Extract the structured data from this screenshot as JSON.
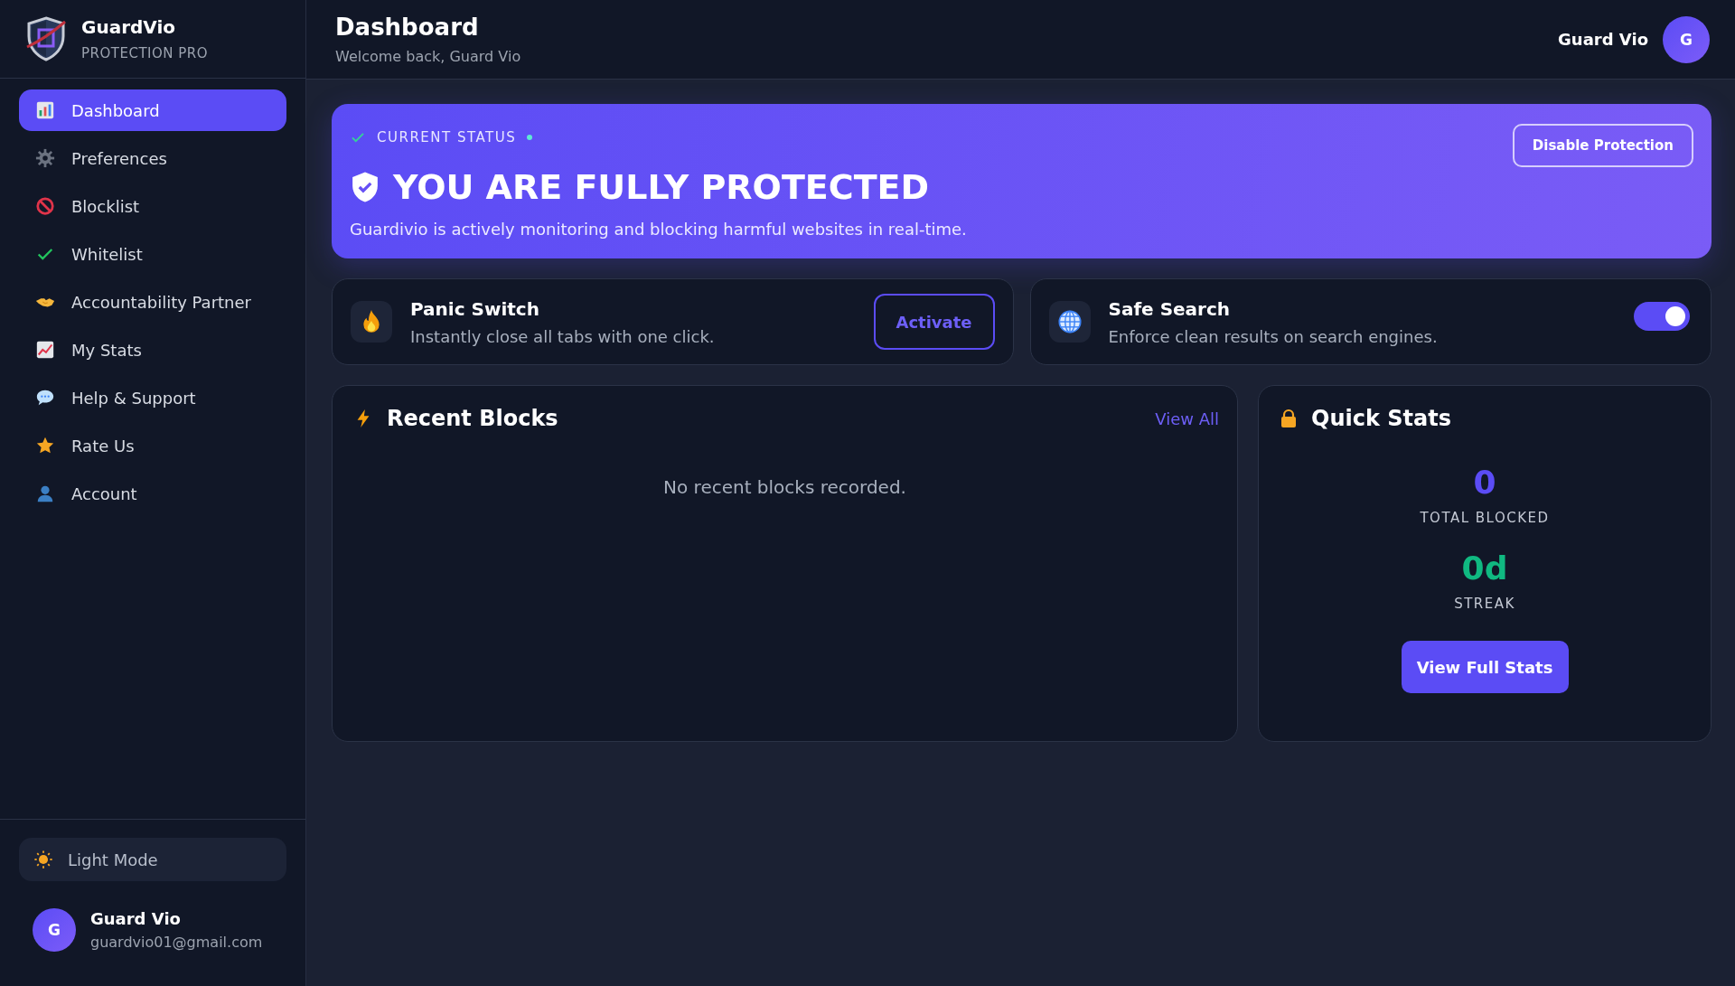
{
  "brand": {
    "name": "GuardVio",
    "tagline": "PROTECTION PRO"
  },
  "sidebar": {
    "items": [
      {
        "label": "Dashboard",
        "selected": true
      },
      {
        "label": "Preferences",
        "selected": false
      },
      {
        "label": "Blocklist",
        "selected": false
      },
      {
        "label": "Whitelist",
        "selected": false
      },
      {
        "label": "Accountability Partner",
        "selected": false
      },
      {
        "label": "My Stats",
        "selected": false
      },
      {
        "label": "Help & Support",
        "selected": false
      },
      {
        "label": "Rate Us",
        "selected": false
      },
      {
        "label": "Account",
        "selected": false
      }
    ],
    "theme_toggle": "Light Mode",
    "user": {
      "initial": "G",
      "name": "Guard Vio",
      "email": "guardvio01@gmail.com"
    }
  },
  "header": {
    "title": "Dashboard",
    "subtitle": "Welcome back, Guard Vio",
    "user_name": "Guard Vio",
    "avatar_initial": "G"
  },
  "status": {
    "label": "CURRENT STATUS",
    "headline": "YOU ARE FULLY PROTECTED",
    "description": "Guardivio is actively monitoring and blocking harmful websites in real-time.",
    "button": "Disable Protection"
  },
  "features": [
    {
      "kind": "button",
      "title": "Panic Switch",
      "description": "Instantly close all tabs with one click.",
      "button": "Activate"
    },
    {
      "kind": "toggle",
      "title": "Safe Search",
      "description": "Enforce clean results on search engines.",
      "on": true
    }
  ],
  "recent_blocks": {
    "title": "Recent Blocks",
    "link": "View All",
    "empty": "No recent blocks recorded."
  },
  "quick_stats": {
    "title": "Quick Stats",
    "stats": [
      {
        "value": "0",
        "label": "TOTAL BLOCKED",
        "color": "#5b4cf5"
      },
      {
        "value": "0d",
        "label": "STREAK",
        "color": "#10b981"
      }
    ],
    "button": "View Full Stats"
  }
}
